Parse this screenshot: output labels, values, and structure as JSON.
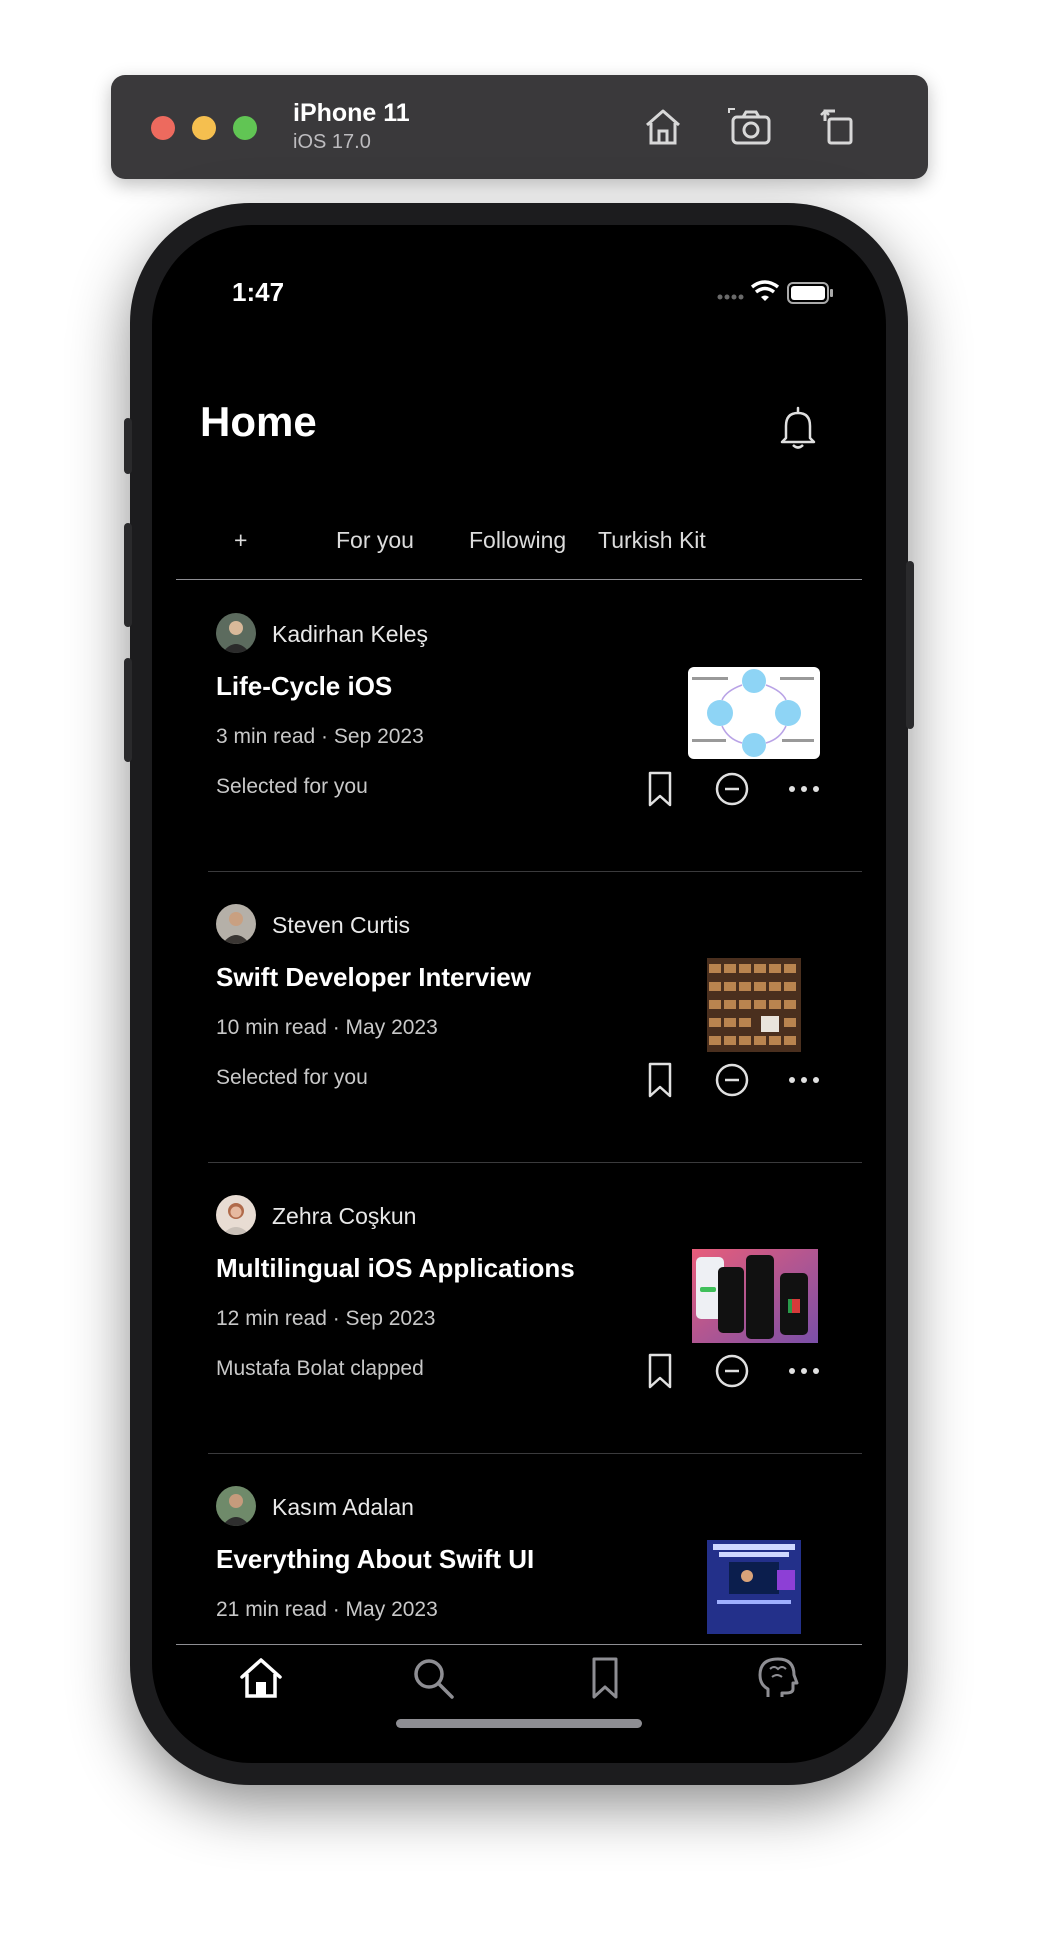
{
  "simulator": {
    "device_name": "iPhone 11",
    "os_version": "iOS 17.0",
    "traffic_lights": [
      "#ed6a5e",
      "#f5bf4f",
      "#61c554"
    ],
    "toolbar_icons": [
      "home-icon",
      "screenshot-icon",
      "rotate-icon"
    ]
  },
  "status_bar": {
    "time": "1:47",
    "icons": [
      "cellular-icon",
      "wifi-icon",
      "battery-icon"
    ]
  },
  "header": {
    "title": "Home",
    "notification_icon": "bell-icon"
  },
  "tabs": [
    {
      "label": "+"
    },
    {
      "label": "For you"
    },
    {
      "label": "Following"
    },
    {
      "label": "Turkish Kit"
    }
  ],
  "feed": [
    {
      "author": "Kadirhan Keleş",
      "title": "Life-Cycle iOS",
      "meta": "3 min read · Sep 2023",
      "reason": "Selected for you"
    },
    {
      "author": "Steven Curtis",
      "title": "Swift Developer Interview",
      "meta": "10 min read · May 2023",
      "reason": "Selected for you"
    },
    {
      "author": "Zehra Coşkun",
      "title": "Multilingual iOS Applications",
      "meta": "12 min read · Sep 2023",
      "reason": "Mustafa Bolat clapped"
    },
    {
      "author": "Kasım Adalan",
      "title": "Everything About Swift UI",
      "meta": "21 min read · May 2023",
      "reason": ""
    }
  ],
  "card_actions": [
    "bookmark-icon",
    "show-less-icon",
    "more-icon"
  ],
  "tab_bar": [
    "home-icon",
    "search-icon",
    "bookmarks-icon",
    "profile-brain-icon"
  ],
  "colors": {
    "background": "#000000",
    "divider": "#3a3a3c",
    "text": "#ffffff"
  }
}
